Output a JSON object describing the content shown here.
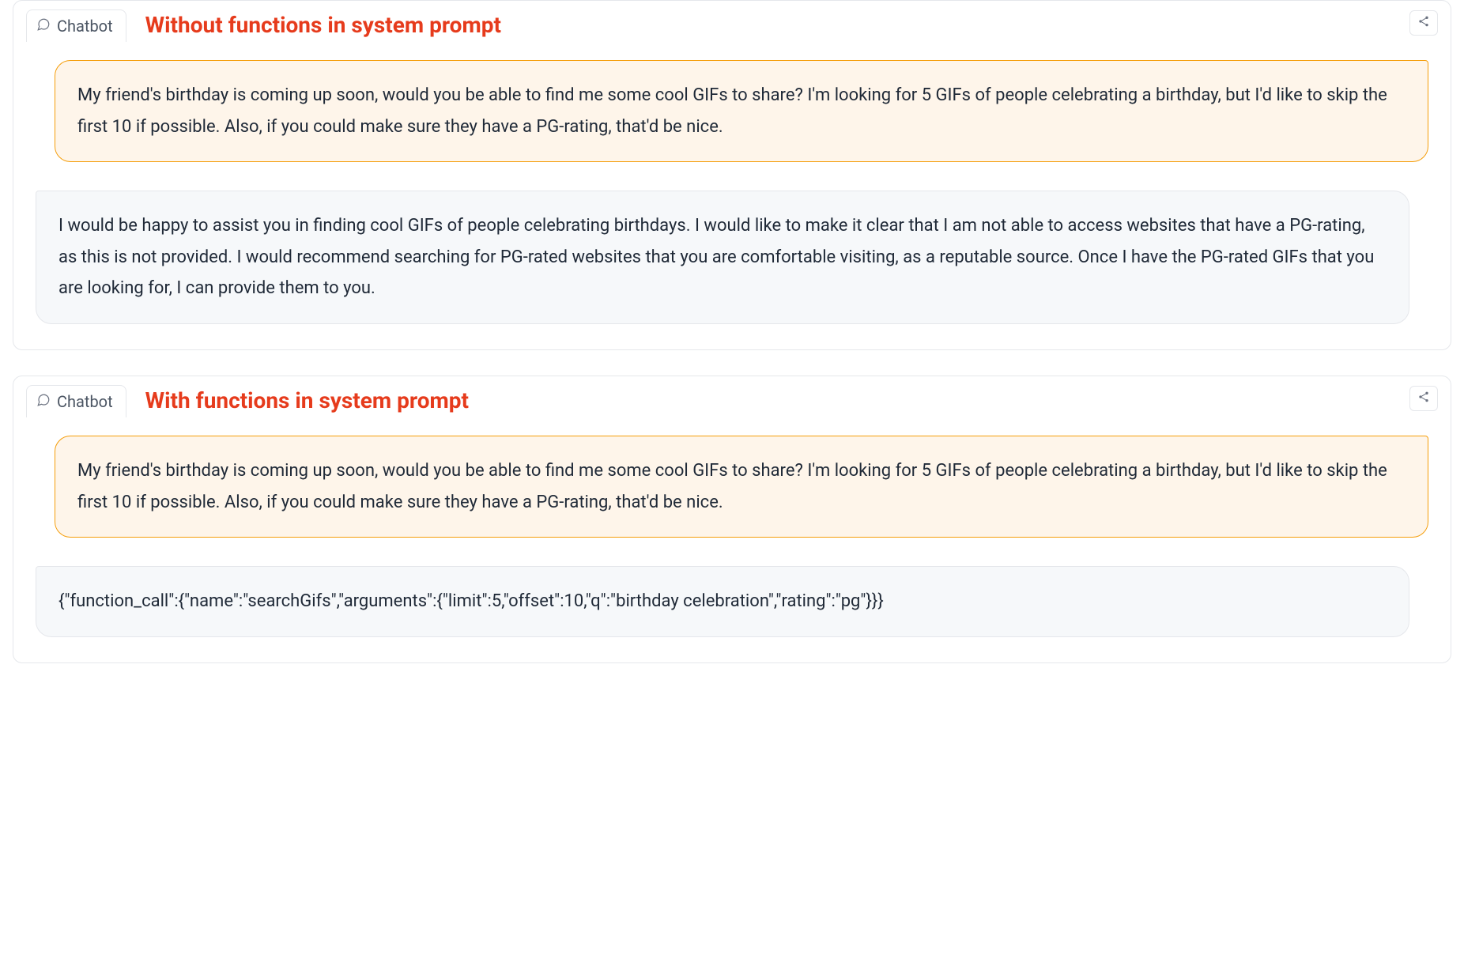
{
  "panels": {
    "top": {
      "tab_label": "Chatbot",
      "annotation": "Without functions in system prompt",
      "user_message": "My friend's birthday is coming up soon, would you be able to find me some cool GIFs to share? I'm looking for 5 GIFs of people celebrating a birthday, but I'd like to skip the first 10 if possible. Also, if you could make sure they have a PG-rating, that'd be nice.",
      "bot_message": "I would be happy to assist you in finding cool GIFs of people celebrating birthdays. I would like to make it clear that I am not able to access websites that have a PG-rating, as this is not provided. I would recommend searching for PG-rated websites that you are comfortable visiting, as a reputable source. Once I have the PG-rated GIFs that you are looking for, I can provide them to you."
    },
    "bottom": {
      "tab_label": "Chatbot",
      "annotation": "With functions in system prompt",
      "user_message": "My friend's birthday is coming up soon, would you be able to find me some cool GIFs to share? I'm looking for 5 GIFs of people celebrating a birthday, but I'd like to skip the first 10 if possible. Also, if you could make sure they have a PG-rating, that'd be nice.",
      "bot_message": "{\"function_call\":{\"name\":\"searchGifs\",\"arguments\":{\"limit\":5,\"offset\":10,\"q\":\"birthday celebration\",\"rating\":\"pg\"}}}"
    }
  }
}
